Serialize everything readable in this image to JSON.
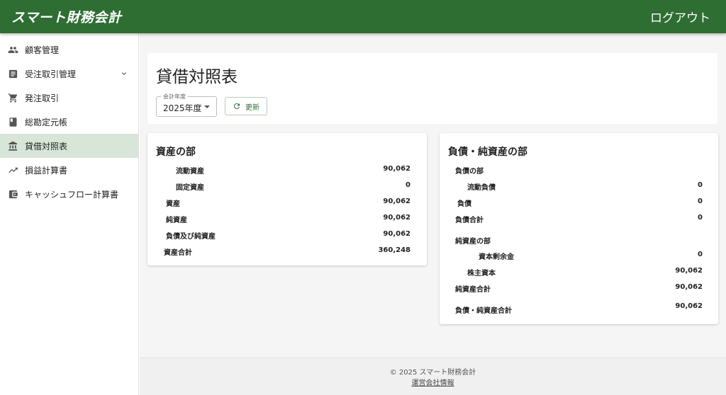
{
  "app": {
    "brand": "スマート財務会計",
    "logout": "ログアウト"
  },
  "sidebar": {
    "items": [
      {
        "label": "顧客管理",
        "icon": "people-icon"
      },
      {
        "label": "受注取引管理",
        "icon": "list-icon"
      },
      {
        "label": "発注取引",
        "icon": "cart-icon"
      },
      {
        "label": "総勘定元帳",
        "icon": "book-icon"
      },
      {
        "label": "貸借対照表",
        "icon": "bank-icon",
        "active": true
      },
      {
        "label": "損益計算書",
        "icon": "trending-up-icon"
      },
      {
        "label": "キャッシュフロー計算書",
        "icon": "wallet-icon"
      }
    ]
  },
  "page": {
    "title": "貸借対照表",
    "year_label": "会計年度",
    "year_value": "2025年度",
    "refresh_label": "更新"
  },
  "assets": {
    "title": "資産の部",
    "rows": [
      {
        "label": "流動資産",
        "value": "90,062"
      },
      {
        "label": "固定資産",
        "value": "0"
      },
      {
        "label": "資産",
        "value": "90,062"
      },
      {
        "label": "純資産",
        "value": "90,062"
      },
      {
        "label": "負債及び純資産",
        "value": "90,062"
      },
      {
        "label": "資産合計",
        "value": "360,248"
      }
    ]
  },
  "liabilities": {
    "title": "負債・純資産の部",
    "rows": [
      {
        "label": "負債の部",
        "value": ""
      },
      {
        "label": "流動負債",
        "value": "0"
      },
      {
        "label": "負債",
        "value": "0"
      },
      {
        "label": "負債合計",
        "value": "0"
      },
      {
        "label": "純資産の部",
        "value": ""
      },
      {
        "label": "資本剰余金",
        "value": "0"
      },
      {
        "label": "株主資本",
        "value": "90,062"
      },
      {
        "label": "純資産合計",
        "value": "90,062"
      },
      {
        "label": "負債・純資産合計",
        "value": "90,062"
      }
    ]
  },
  "footer": {
    "copyright": "© 2025 スマート財務会計",
    "company_link": "運営会社情報"
  },
  "colors": {
    "primary": "#2e6e33",
    "active_bg": "#d8e6d9",
    "background": "#f5f5f5"
  }
}
